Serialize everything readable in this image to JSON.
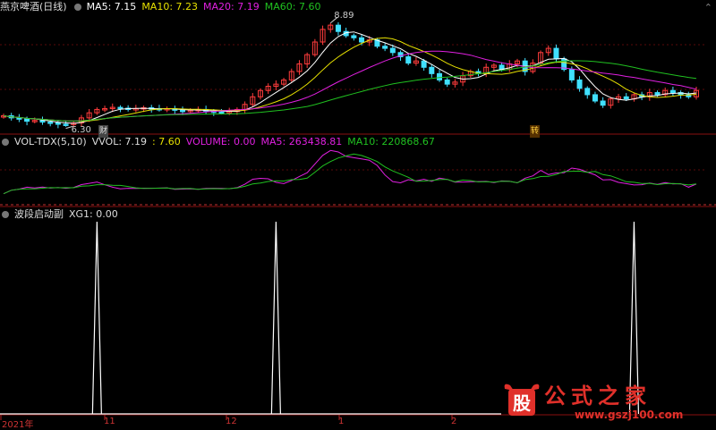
{
  "price_panel": {
    "title": "燕京啤酒(日线)",
    "ma5": "MA5: 7.15",
    "ma10": "MA10: 7.23",
    "ma20": "MA20: 7.19",
    "ma60": "MA60: 7.60",
    "high_label": "8.89",
    "low_label": "6.30",
    "marker_left": "财",
    "marker_right": "转"
  },
  "volume_panel": {
    "name": "VOL-TDX(5,10)",
    "vvol": "VVOL: 7.19",
    "vvol2": ": 7.60",
    "volume": "VOLUME: 0.00",
    "ma5": "MA5: 263438.81",
    "ma10": "MA10: 220868.67"
  },
  "signal_panel": {
    "name": "波段启动副",
    "xg1": "XG1: 0.00"
  },
  "x_axis": {
    "labels": [
      "2021年",
      "11",
      "12",
      "1",
      "2"
    ]
  },
  "watermark": {
    "text": "公式之家",
    "url": "www.gszj100.com",
    "mark": "股"
  },
  "colors": {
    "ma5": "#ffffff",
    "ma10": "#e6e000",
    "ma20": "#e020e0",
    "ma60": "#20c020",
    "up": "#ff3c3c",
    "down": "#40e0ff",
    "signal": "#ffffff",
    "axis": "#b02020"
  },
  "chart_data": [
    {
      "type": "candlestick",
      "title": "燕京啤酒(日线)",
      "series": [
        {
          "name": "MA5",
          "last": 7.15
        },
        {
          "name": "MA10",
          "last": 7.23
        },
        {
          "name": "MA20",
          "last": 7.19
        },
        {
          "name": "MA60",
          "last": 7.6
        }
      ],
      "annotations": [
        {
          "text": "8.89",
          "kind": "high"
        },
        {
          "text": "6.30",
          "kind": "low"
        }
      ],
      "close_path": [
        6.55,
        6.5,
        6.48,
        6.42,
        6.44,
        6.4,
        6.38,
        6.35,
        6.34,
        6.38,
        6.5,
        6.62,
        6.7,
        6.72,
        6.75,
        6.73,
        6.7,
        6.72,
        6.74,
        6.72,
        6.7,
        6.72,
        6.68,
        6.66,
        6.68,
        6.7,
        6.66,
        6.64,
        6.63,
        6.65,
        6.7,
        6.82,
        7.0,
        7.15,
        7.25,
        7.3,
        7.4,
        7.6,
        7.78,
        8.0,
        8.3,
        8.6,
        8.7,
        8.55,
        8.45,
        8.4,
        8.3,
        8.35,
        8.2,
        8.15,
        8.05,
        7.95,
        7.8,
        7.85,
        7.7,
        7.55,
        7.4,
        7.3,
        7.35,
        7.5,
        7.6,
        7.55,
        7.7,
        7.75,
        7.65,
        7.78,
        7.85,
        7.6,
        7.8,
        8.05,
        8.15,
        7.9,
        7.65,
        7.4,
        7.2,
        7.05,
        6.9,
        6.8,
        6.95,
        7.0,
        6.95,
        7.05,
        7.0,
        7.1,
        7.05,
        7.15,
        7.1,
        7.05,
        7.0,
        7.15
      ]
    },
    {
      "type": "line",
      "title": "VOL-TDX(5,10)",
      "series": [
        {
          "name": "VVOL",
          "last": 7.19
        },
        {
          "name": "",
          "last": 7.6
        }
      ]
    },
    {
      "type": "line",
      "title": "波段启动副",
      "series": [
        {
          "name": "XG1",
          "last": 0.0
        }
      ],
      "signal_spikes": [
        {
          "index": 12,
          "value": 1
        },
        {
          "index": 35,
          "value": 1
        },
        {
          "index": 81,
          "value": 1
        }
      ]
    }
  ]
}
